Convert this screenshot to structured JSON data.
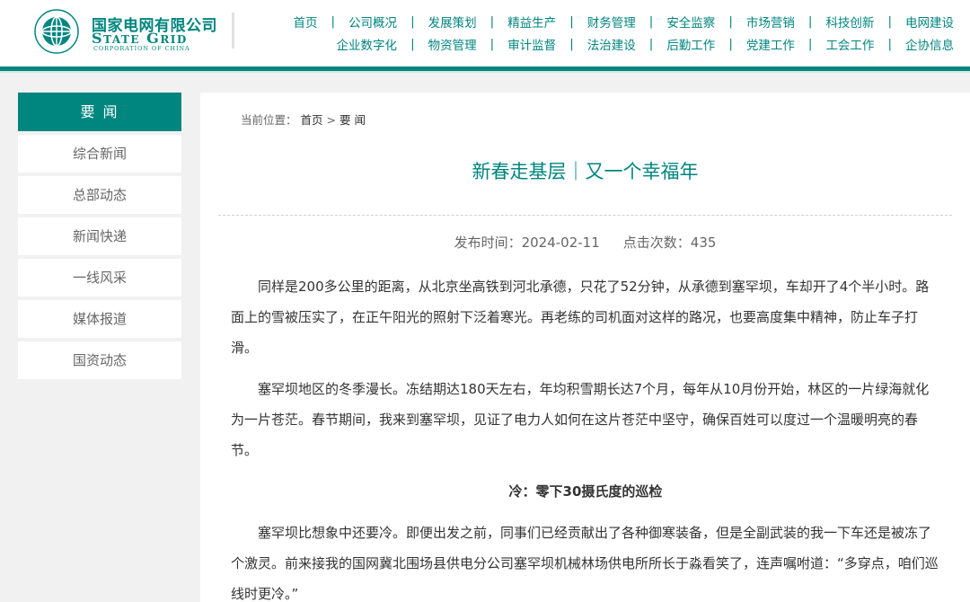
{
  "header": {
    "logo_cn": "国家电网有限公司",
    "logo_en": "State Grid",
    "logo_sub": "CORPORATION OF CHINA",
    "logo_ring_text": "国家电网公司 STATE GRID CORPORATION OF CHINA",
    "brand_color": "#00857f",
    "nav_row1": [
      "首页",
      "公司概况",
      "发展策划",
      "精益生产",
      "财务管理",
      "安全监察",
      "市场营销",
      "科技创新",
      "电网建设"
    ],
    "nav_row2": [
      "企业数字化",
      "物资管理",
      "审计监督",
      "法治建设",
      "后勤工作",
      "党建工作",
      "工会工作",
      "企协信息"
    ],
    "nav_separator": "|"
  },
  "sidebar": {
    "items": [
      {
        "label": "要 闻",
        "active": true
      },
      {
        "label": "综合新闻",
        "active": false
      },
      {
        "label": "总部动态",
        "active": false
      },
      {
        "label": "新闻快递",
        "active": false
      },
      {
        "label": "一线风采",
        "active": false
      },
      {
        "label": "媒体报道",
        "active": false
      },
      {
        "label": "国资动态",
        "active": false
      }
    ]
  },
  "breadcrumb": {
    "prefix": "当前位置：",
    "home": "首页",
    "sep": ">",
    "current": "要 闻"
  },
  "article": {
    "title": "新春走基层｜又一个幸福年",
    "publish_label": "发布时间：",
    "publish_date": "2024-02-11",
    "clicks_label": "点击次数：",
    "clicks": "435",
    "paragraphs": [
      "同样是200多公里的距离，从北京坐高铁到河北承德，只花了52分钟，从承德到塞罕坝，车却开了4个半小时。路面上的雪被压实了，在正午阳光的照射下泛着寒光。再老练的司机面对这样的路况，也要高度集中精神，防止车子打滑。",
      "塞罕坝地区的冬季漫长。冻结期达180天左右，年均积雪期长达7个月，每年从10月份开始，林区的一片绿海就化为一片苍茫。春节期间，我来到塞罕坝，见证了电力人如何在这片苍茫中坚守，确保百姓可以度过一个温暖明亮的春节。"
    ],
    "subheading": "冷：零下30摄氏度的巡检",
    "paragraph3": "塞罕坝比想象中还要冷。即便出发之前，同事们已经贡献出了各种御寒装备，但是全副武装的我一下车还是被冻了个激灵。前来接我的国网冀北围场县供电分公司塞罕坝机械林场供电所所长于淼看笑了，连声嘱咐道：“多穿点，咱们巡线时更冷。”"
  }
}
